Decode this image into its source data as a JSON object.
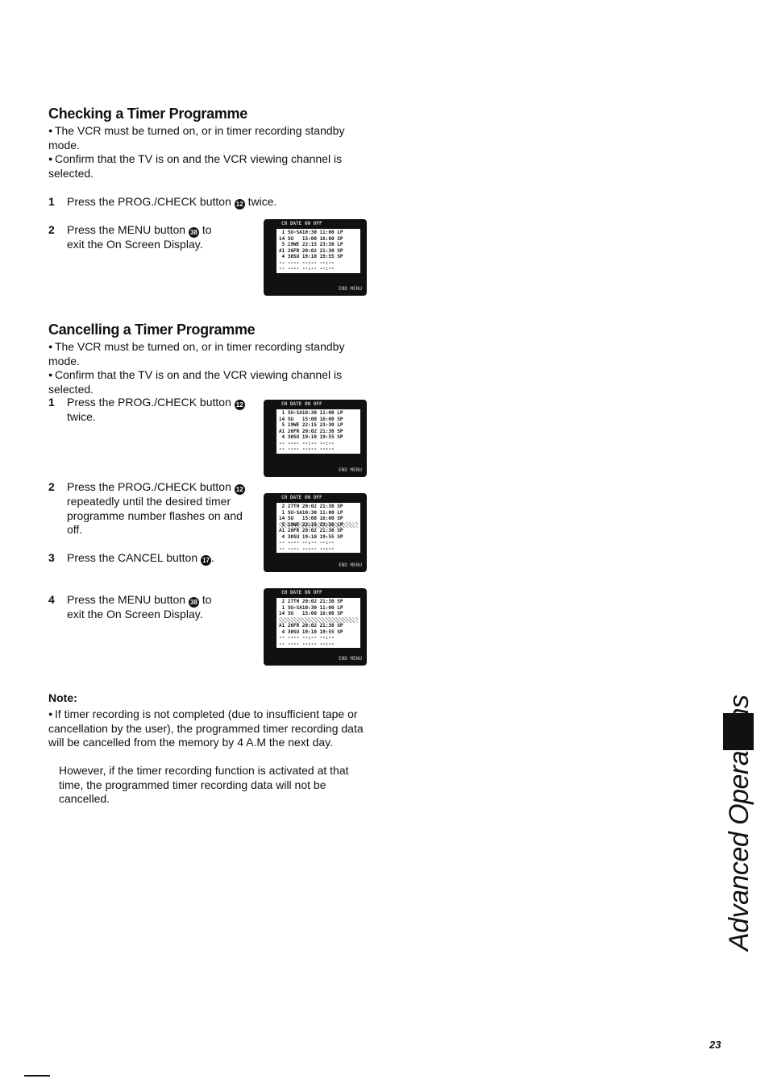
{
  "checking": {
    "title": "Checking a Timer Programme",
    "bullets": [
      "The VCR must be turned on, or in timer recording standby mode.",
      "Confirm that the TV is on and the VCR viewing channel is selected."
    ],
    "steps": [
      {
        "num": "1",
        "text_before": "Press the PROG./CHECK button",
        "icon": "12",
        "text_after": "twice."
      },
      {
        "num": "2",
        "text_before": "Press the MENU button",
        "icon": "38",
        "text_after": "to exit the On Screen Display."
      }
    ]
  },
  "cancelling": {
    "title": "Cancelling a Timer Programme",
    "bullets": [
      "The VCR must be turned on, or in timer recording standby mode.",
      "Confirm that the TV is on and the VCR viewing channel is selected."
    ],
    "steps": [
      {
        "num": "1",
        "text_before": "Press the PROG./CHECK button",
        "icon": "12",
        "text_after": "twice."
      },
      {
        "num": "2",
        "text_before": "Press the PROG./CHECK button",
        "icon": "12",
        "text_after": "repeatedly until the desired timer programme number flashes on and off."
      },
      {
        "num": "3",
        "text_before": "Press the CANCEL button",
        "icon": "17",
        "text_after": "."
      },
      {
        "num": "4",
        "text_before": "Press the MENU button",
        "icon": "38",
        "text_after": "to exit the On Screen Display."
      }
    ]
  },
  "osd": {
    "header": "CH DATE  ON    OFF",
    "footer": "END MENU",
    "screens": [
      {
        "rows": [
          " 1 SU-SA10:30 11:00 LP",
          "14 SU   15:00 16:00 SP",
          " 5 19WE 22:15 23:30 LP",
          "A1 26FR 20:02 21:30 SP",
          " 4 30SU 19:10 19:55 SP",
          "-- ---- --:-- --:--",
          "-- ---- --:-- --:--"
        ],
        "flash": -1
      },
      {
        "rows": [
          " 1 SU-SA10:30 11:00 LP",
          "14 SU   15:00 16:00 SP",
          " 5 19WE 22:15 23:30 LP",
          "A1 26FR 20:02 21:30 SP",
          " 4 30SU 19:10 19:55 SP",
          "-- ---- --:-- --:--",
          "-- ---- --:-- --:--"
        ],
        "flash": -1
      },
      {
        "rows": [
          " 2 27TH 20:02 21:30 SP",
          " 1 SU-SA10:30 11:00 LP",
          "14 SU   15:00 16:00 SP",
          " 5 19WE 22:15 23:30 LP",
          "A1 26FR 20:02 21:30 SP",
          " 4 30SU 19:10 19:55 SP",
          "-- ---- --:-- --:--",
          "-- ---- --:-- --:--"
        ],
        "flash": 3
      },
      {
        "rows": [
          " 2 27TH 20:02 21:30 SP",
          " 1 SU-SA10:30 11:00 LP",
          "14 SU   15:00 16:00 SP",
          "",
          "A1 26FR 20:02 21:30 SP",
          " 4 30SU 19:10 19:55 SP",
          "-- ---- --:-- --:--",
          "-- ---- --:-- --:--"
        ],
        "flash": 3
      }
    ]
  },
  "note": {
    "title": "Note:",
    "text": "If timer recording is not completed (due to insufficient tape or cancellation by the user), the programmed timer recording data will be cancelled from the memory by 4 A.M the next day.",
    "text2": "However, if the timer recording function is activated at that time, the programmed timer recording data will not be cancelled."
  },
  "side_tab": "Advanced Operations",
  "page_number": "23"
}
